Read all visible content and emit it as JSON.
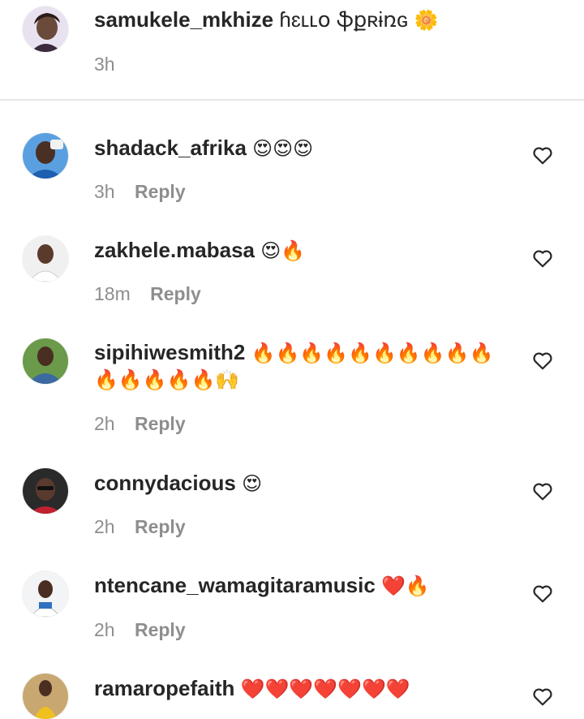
{
  "caption": {
    "username": "samukele_mkhize",
    "text": "ɦɛʟʟօ ֆքʀɨռɢ",
    "emoji": "🌼",
    "time": "3h"
  },
  "comments": [
    {
      "username": "shadack_afrika",
      "text": "😍😍😍",
      "time": "3h",
      "reply": "Reply"
    },
    {
      "username": "zakhele.mabasa",
      "text": "😍🔥",
      "time": "18m",
      "reply": "Reply"
    },
    {
      "username": "sipihiwesmith2",
      "text": "🔥🔥🔥🔥🔥🔥🔥🔥🔥🔥",
      "text2": "🔥🔥🔥🔥🔥🙌",
      "time": "2h",
      "reply": "Reply"
    },
    {
      "username": "connydacious",
      "text": "😍",
      "time": "2h",
      "reply": "Reply"
    },
    {
      "username": "ntencane_wamagitaramusic",
      "text": "❤️🔥",
      "time": "2h",
      "reply": "Reply"
    },
    {
      "username": "ramaropefaith",
      "text": "❤️❤️❤️❤️❤️❤️❤️",
      "time": "",
      "reply": ""
    }
  ],
  "colors": {
    "text": "#262626",
    "secondary": "#8e8e8e",
    "divider": "#e6e6e6"
  }
}
